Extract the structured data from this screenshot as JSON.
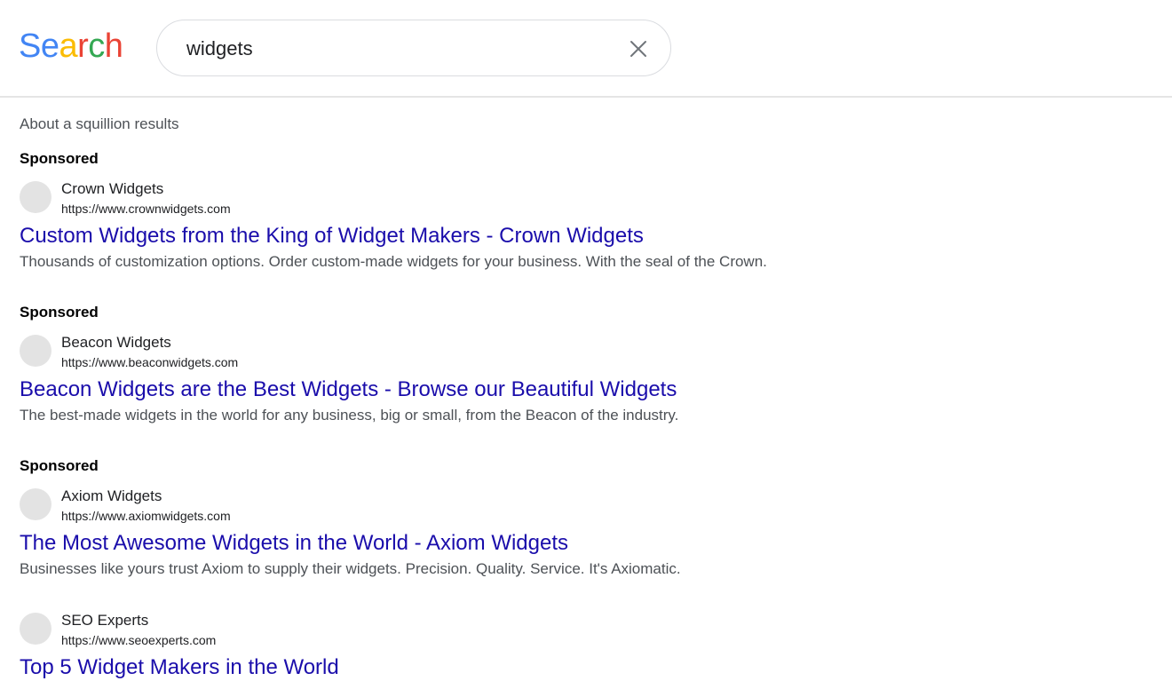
{
  "logo": {
    "letters": [
      {
        "char": "S",
        "color": "#4285F4"
      },
      {
        "char": "e",
        "color": "#4285F4"
      },
      {
        "char": "a",
        "color": "#FBBC05"
      },
      {
        "char": "r",
        "color": "#EA4335"
      },
      {
        "char": "c",
        "color": "#34A853"
      },
      {
        "char": "h",
        "color": "#EA4335"
      }
    ]
  },
  "search": {
    "value": "widgets",
    "clear_icon": "close-icon"
  },
  "result_stats": "About a squillion results",
  "results": [
    {
      "sponsored_label": "Sponsored",
      "site_name": "Crown Widgets",
      "url": "https://www.crownwidgets.com",
      "title": "Custom Widgets from the King of Widget Makers - Crown Widgets",
      "snippet": "Thousands of customization options. Order custom-made widgets for your business. With the seal of the Crown."
    },
    {
      "sponsored_label": "Sponsored",
      "site_name": "Beacon Widgets",
      "url": "https://www.beaconwidgets.com",
      "title": "Beacon Widgets are the Best Widgets - Browse our Beautiful Widgets",
      "snippet": "The best-made widgets in the world for any business, big or small, from the Beacon of the industry."
    },
    {
      "sponsored_label": "Sponsored",
      "site_name": "Axiom Widgets",
      "url": "https://www.axiomwidgets.com",
      "title": "The Most Awesome Widgets in the World - Axiom Widgets",
      "snippet": "Businesses like yours trust Axiom to supply their widgets. Precision. Quality. Service. It's Axiomatic."
    },
    {
      "sponsored_label": "",
      "site_name": "SEO Experts",
      "url": "https://www.seoexperts.com",
      "title": "Top 5 Widget Makers in the World",
      "snippet": ""
    }
  ],
  "colors": {
    "link": "#1a0dab",
    "snippet": "#4d5156"
  }
}
